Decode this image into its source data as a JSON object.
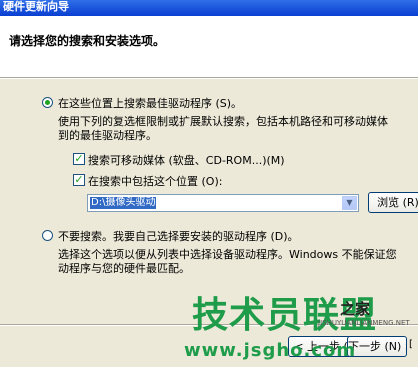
{
  "window": {
    "title": "硬件更新向导"
  },
  "header": {
    "title": "请选择您的搜索和安装选项。"
  },
  "option_search": {
    "label": "在这些位置上搜索最佳驱动程序 (S)。",
    "selected": true,
    "desc_line1": "使用下列的复选框限制或扩展默认搜索，包括本机路径和可移动媒体",
    "desc_line2": "到的最佳驱动程序。",
    "check_removable": {
      "label": "搜索可移动媒体 (软盘、CD-ROM...)(M)",
      "checked": true
    },
    "check_location": {
      "label": "在搜索中包括这个位置 (O):",
      "checked": true
    },
    "location_value": "D:\\摄像头驱动",
    "browse_label": "浏览 (R)"
  },
  "option_manual": {
    "label": "不要搜索。我要自己选择要安装的驱动程序 (D)。",
    "selected": false,
    "desc_line1": "选择这个选项以便从列表中选择设备驱动程序。Windows 不能保证您",
    "desc_line2": "动程序与您的硬件最匹配。"
  },
  "footer": {
    "back_label": "< 上一步 (B)",
    "next_label": "下一步 (N) >"
  },
  "watermark": {
    "main": "技术员联盟",
    "side": "之家",
    "sub": "JISHUYUANLIANMENG.NET",
    "url": "www.jsgho.com"
  }
}
